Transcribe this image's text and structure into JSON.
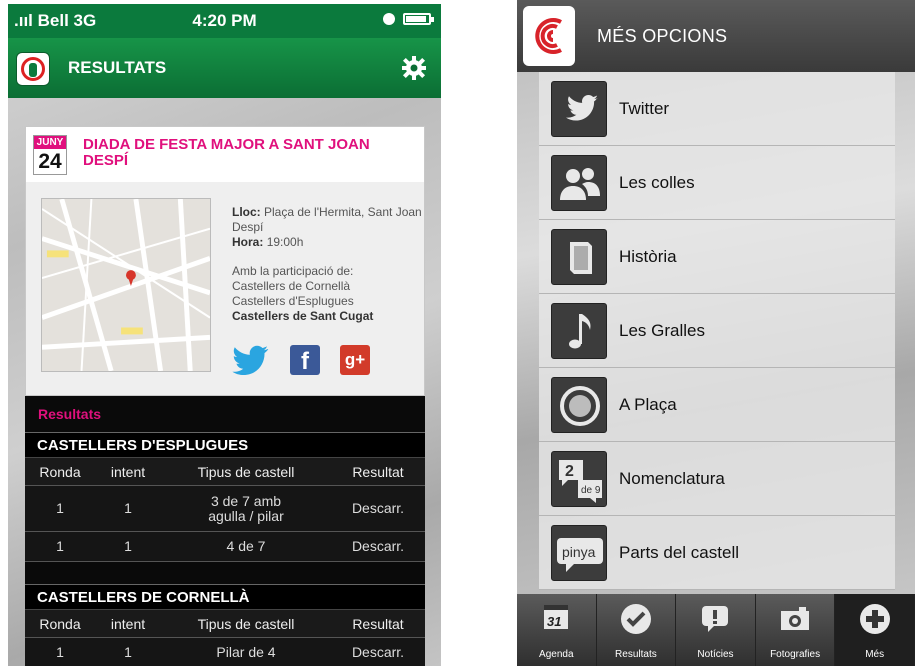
{
  "left": {
    "status": {
      "signal": ".ııl Bell 3G",
      "time": "4:20 PM"
    },
    "nav": {
      "title": "RESULTATS"
    },
    "event": {
      "month": "JUNY",
      "day": "24",
      "title": "DIADA DE FESTA MAJOR A SANT JOAN DESPÍ",
      "lloc_label": "Lloc:",
      "lloc_value": "Plaça de l'Hermita, Sant Joan Despí",
      "hora_label": "Hora:",
      "hora_value": "19:00h",
      "participation_intro": "Amb la  participació de:",
      "participants": [
        "Castellers de Cornellà",
        "Castellers d'Esplugues"
      ],
      "participant_highlight": "Castellers de Sant Cugat"
    },
    "results": {
      "title": "Resultats",
      "columns": [
        "Ronda",
        "intent",
        "Tipus de castell",
        "Resultat"
      ],
      "teams": [
        {
          "name": "CASTELLERS D'ESPLUGUES",
          "rows": [
            [
              "1",
              "1",
              "3 de 7 amb agulla / pilar",
              "Descarr."
            ],
            [
              "1",
              "1",
              "4 de 7",
              "Descarr."
            ]
          ]
        },
        {
          "name": "CASTELLERS DE CORNELLÀ",
          "rows": [
            [
              "1",
              "1",
              "Pilar de 4",
              "Descarr."
            ]
          ]
        }
      ]
    }
  },
  "right": {
    "nav": {
      "title": "MÉS OPCIONS"
    },
    "menu": [
      {
        "label": "Twitter",
        "icon": "twitter-bird-icon"
      },
      {
        "label": "Les colles",
        "icon": "people-icon"
      },
      {
        "label": "Història",
        "icon": "book-icon"
      },
      {
        "label": "Les Gralles",
        "icon": "music-note-icon"
      },
      {
        "label": "A Plaça",
        "icon": "circle-target-icon"
      },
      {
        "label": "Nomenclatura",
        "icon": "speech-bubbles-icon",
        "badge_top": "2",
        "badge_bottom": "de 9"
      },
      {
        "label": "Parts del castell",
        "icon": "pinya-bubble-icon",
        "badge": "pinya"
      }
    ],
    "tabs": [
      {
        "label": "Agenda",
        "icon": "calendar-icon",
        "icon_text": "31"
      },
      {
        "label": "Resultats",
        "icon": "checkmark-icon"
      },
      {
        "label": "Notícies",
        "icon": "exclamation-bubble-icon"
      },
      {
        "label": "Fotografies",
        "icon": "camera-icon"
      },
      {
        "label": "Més",
        "icon": "plus-icon",
        "active": true
      }
    ]
  },
  "colors": {
    "green": "#0b7a3d",
    "magenta": "#e0107d",
    "dark": "#0a0a0a",
    "gray_bar": "#3a3a3a"
  }
}
